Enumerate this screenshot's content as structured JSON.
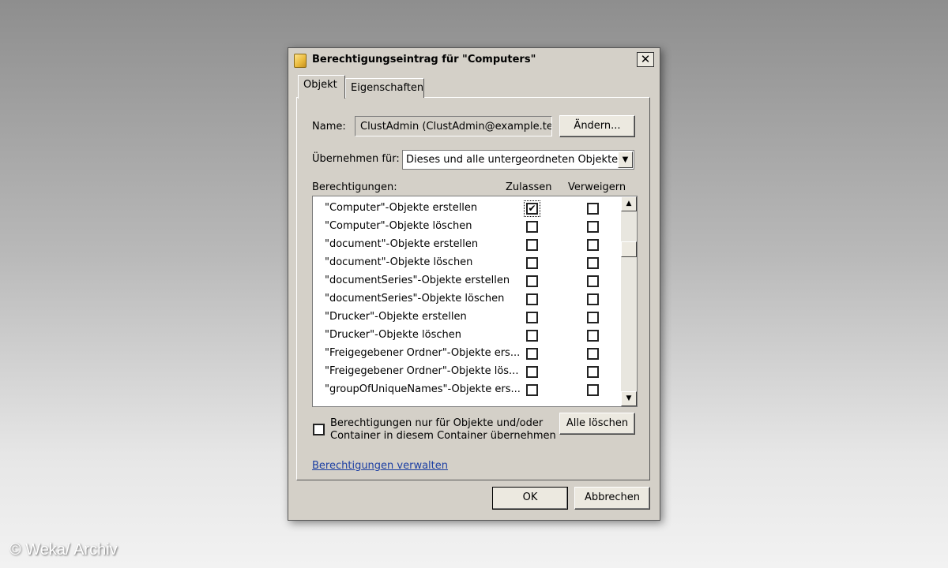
{
  "window": {
    "title": "Berechtigungseintrag für \"Computers\"",
    "close": "✕"
  },
  "tabs": [
    {
      "label": "Objekt"
    },
    {
      "label": "Eigenschaften"
    }
  ],
  "name_row": {
    "label": "Name:",
    "value": "ClustAdmin (ClustAdmin@example.test",
    "change_button": "Ändern..."
  },
  "apply_row": {
    "label": "Übernehmen für:",
    "value": "Dieses und alle untergeordneten Objekte"
  },
  "permissions": {
    "header": "Berechtigungen:",
    "allow_header": "Zulassen",
    "deny_header": "Verweigern",
    "rows": [
      {
        "name": "\"Computer\"-Objekte erstellen",
        "allow": true,
        "deny": false
      },
      {
        "name": "\"Computer\"-Objekte löschen",
        "allow": false,
        "deny": false
      },
      {
        "name": "\"document\"-Objekte erstellen",
        "allow": false,
        "deny": false
      },
      {
        "name": "\"document\"-Objekte löschen",
        "allow": false,
        "deny": false
      },
      {
        "name": "\"documentSeries\"-Objekte erstellen",
        "allow": false,
        "deny": false
      },
      {
        "name": "\"documentSeries\"-Objekte löschen",
        "allow": false,
        "deny": false
      },
      {
        "name": "\"Drucker\"-Objekte erstellen",
        "allow": false,
        "deny": false
      },
      {
        "name": "\"Drucker\"-Objekte löschen",
        "allow": false,
        "deny": false
      },
      {
        "name": "\"Freigegebener Ordner\"-Objekte ers...",
        "allow": false,
        "deny": false
      },
      {
        "name": "\"Freigegebener Ordner\"-Objekte lös...",
        "allow": false,
        "deny": false
      },
      {
        "name": "\"groupOfUniqueNames\"-Objekte ers...",
        "allow": false,
        "deny": false
      }
    ]
  },
  "inherit_option": {
    "line1": "Berechtigungen nur für Objekte und/oder",
    "line2": "Container in diesem Container übernehmen",
    "checked": false
  },
  "clear_all_button": "Alle löschen",
  "manage_link": "Berechtigungen verwalten",
  "ok_button": "OK",
  "cancel_button": "Abbrechen",
  "watermark": "© Weka/ Archiv",
  "icons": {
    "title": "folder-icon",
    "check": "✔",
    "up": "▲",
    "down": "▼"
  }
}
